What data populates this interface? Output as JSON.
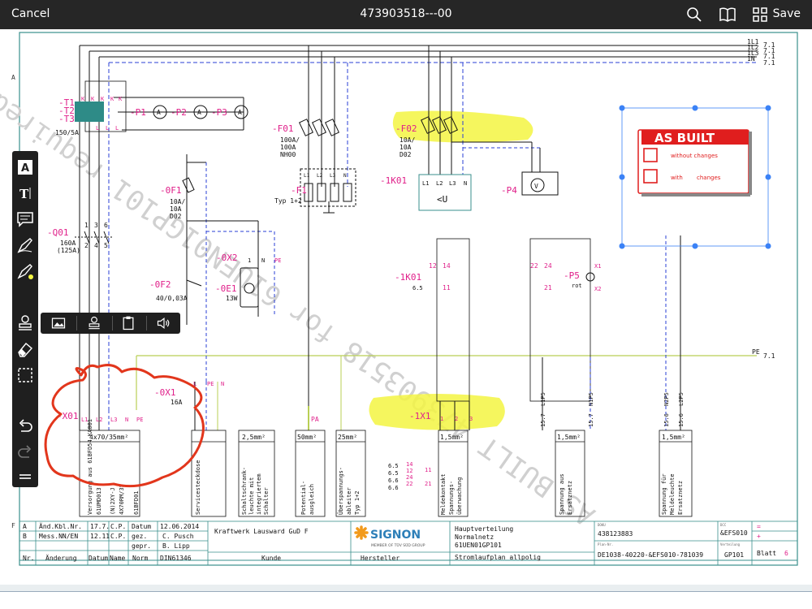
{
  "toolbar": {
    "cancel_label": "Cancel",
    "title": "473903518---00",
    "save_label": "Save",
    "icons": [
      "search-icon",
      "book-icon",
      "grid-icon"
    ]
  },
  "palette": {
    "tools": [
      "text-box-icon",
      "text-icon",
      "note-icon",
      "pen-icon",
      "highlighter-icon",
      "stamp-icon",
      "eraser-icon",
      "select-icon",
      "undo-icon",
      "redo-icon",
      "menu-icon"
    ],
    "flyout": [
      "image-icon",
      "stamp-icon",
      "clipboard-icon",
      "audio-icon"
    ]
  },
  "stamp": {
    "title": "AS BUILT",
    "option1": "without changes",
    "option2a": "with",
    "option2b": "changes",
    "accent": "#e01e1e"
  },
  "colors": {
    "wire_blue": "#2a3fd6",
    "wire_black": "#111111",
    "pe_green": "#b9cf55",
    "label_magenta": "#e0208a",
    "highlight": "#f3f542",
    "markup_red": "#e2361c",
    "frame_teal": "#3a8f8c"
  },
  "watermark": "AS BUILT 473903518 for 61UEN01GP101 required",
  "buses": [
    "1L1",
    "1L2",
    "1L3",
    "1N"
  ],
  "bus_ref": "7.1",
  "pe": {
    "label": "PE",
    "ref": "7.1"
  },
  "border_marks": {
    "row_a": "A",
    "row_f": "F"
  },
  "components": {
    "t": {
      "l1": "-T1",
      "l2": "-T2",
      "l3": "-T3",
      "rating": "150/5A",
      "k": "K",
      "l": "L"
    },
    "p1": "-P1",
    "p2": "-P2",
    "p3": "-P3",
    "ammeter": "A",
    "f01": {
      "name": "-F01",
      "r1": "100A/",
      "r2": "100A",
      "r3": "NH00"
    },
    "f1": {
      "name": "-F1",
      "type": "Typ 1+2",
      "t1": "L1",
      "t2": "L2",
      "t3": "L3",
      "t4": "N"
    },
    "f02": {
      "name": "-F02",
      "r1": "10A/",
      "r2": "10A",
      "r3": "D02"
    },
    "k01": {
      "name": "-1K01",
      "t1": "L1",
      "t2": "L2",
      "t3": "L3",
      "t4": "N",
      "sym": "<U"
    },
    "p4": {
      "name": "-P4",
      "sym": "V"
    },
    "q01": {
      "name": "-Q01",
      "r1": "160A",
      "r2": "(125A)"
    },
    "of1": {
      "name": "-0F1",
      "r1": "10A/",
      "r2": "10A",
      "r3": "D02"
    },
    "of2": {
      "name": "-0F2",
      "r1": "40/0,03A"
    },
    "ox2": {
      "name": "-0X2",
      "t1": "1",
      "t2": "N",
      "t3": "PE"
    },
    "oe1": {
      "name": "-0E1",
      "r1": "13W"
    },
    "k01c": {
      "name": "-1K01",
      "ref": "6.5",
      "c1": "12",
      "c2": "14",
      "c3": "11"
    },
    "rly": {
      "c1": "22",
      "c2": "24",
      "c3": "21"
    },
    "p5": {
      "name": "-P5",
      "color": "rot",
      "x1": "X1",
      "x2": "X2"
    },
    "x01": {
      "name": "-X01",
      "t1": "L1",
      "t2": "L2",
      "t3": "L3",
      "t4": "N",
      "t5": "PE"
    },
    "ox1": {
      "name": "-0X1",
      "r1": "16A",
      "t1": "L",
      "t2": "PE",
      "t3": "N"
    },
    "x1": {
      "name": "-1X1",
      "t1": "1",
      "t2": "2",
      "t3": "3"
    },
    "pa": "PA",
    "pin_a": "1",
    "pin_b": "2",
    "pin_c": "3",
    "pin_d": "4",
    "pin_e": "5",
    "pin_f": "6",
    "cross_nums": [
      "L1P5",
      "N1P5",
      "N2P5",
      "L2P5"
    ],
    "cross_refs": [
      "15.7",
      "15.7",
      "15.6",
      "15.6"
    ]
  },
  "cables": {
    "c1": {
      "size": "4x70/35mm²",
      "d1": "Versorgung aus 61BFD54 KA001",
      "d2": "61UMD013",
      "d3": "(N)2XY-J",
      "d4": "4X70RM/35",
      "d5": "61BFD01"
    },
    "c2": {
      "d1": "Servicesteckdose"
    },
    "c3": {
      "size": "2,5mm²",
      "d1": "Schaltschrank-",
      "d2": "leuchte mit",
      "d3": "integriertem",
      "d4": "Schalter"
    },
    "c4": {
      "size": "50mm²",
      "d1": "Potential-",
      "d2": "ausgleich"
    },
    "c5": {
      "size": "25mm²",
      "d1": "Überspannungs-",
      "d2": "ableiter",
      "d3": "Typ 1+2"
    },
    "c6": {
      "size": "1,5mm²",
      "d1": "Meldekontakt",
      "d2": "Spannungs-",
      "d3": "überwachung"
    },
    "c7": {
      "size": "1,5mm²",
      "d1": "Spannung aus",
      "d2": "Ersatznetz"
    },
    "c8": {
      "size": "1,5mm²",
      "d1": "Spannung für",
      "d2": "Meldeleuchte",
      "d3": "Ersatznetz"
    },
    "xref": {
      "r1": "6.5",
      "r2": "6.5",
      "r3": "6.6",
      "r4": "6.6",
      "a1": "14",
      "a2": "12",
      "a3": "24",
      "a4": "22",
      "b1": "11",
      "b2": "21"
    }
  },
  "titleblock": {
    "rev": [
      {
        "id": "A",
        "desc": "Änd.Kbl.Nr.",
        "date": "17.7.",
        "name": "C.P.",
        "k": "Datum",
        "v": "12.06.2014"
      },
      {
        "id": "B",
        "desc": "Mess.NN/EN",
        "date": "12.11",
        "name": "C.P.",
        "k": "gez.",
        "v": "C. Pusch"
      },
      {
        "id": "",
        "desc": "",
        "date": "",
        "name": "",
        "k": "gepr.",
        "v": "B. Lipp"
      }
    ],
    "header": {
      "nr": "Nr.",
      "aenderung": "Änderung",
      "datum": "Datum",
      "name": "Name",
      "norm": "Norm",
      "norm_v": "DIN61346",
      "kunde": "Kunde",
      "hersteller": "Hersteller"
    },
    "customer": "Kraftwerk Lausward GuD F",
    "logo": "SIGNON",
    "logo_sub": "MEMBER OF TÜV SÜD GROUP",
    "desc1": "Hauptverteilung",
    "desc2": "Normalnetz",
    "desc3": "61UEN01GP101",
    "desc4": "Stromlaufplan allpolig",
    "order_label": "DOKU",
    "order": "438123883",
    "plan_label": "Plan-Nr.",
    "plan": "DE1038-40220-&EFS010-781039",
    "doc_label": "DCC",
    "doc": "&EFS010",
    "loc_label": "Verteilung",
    "loc": "GP101",
    "sign1": "=",
    "sign2": "+",
    "sheet_label": "Blatt",
    "sheet": "6"
  }
}
